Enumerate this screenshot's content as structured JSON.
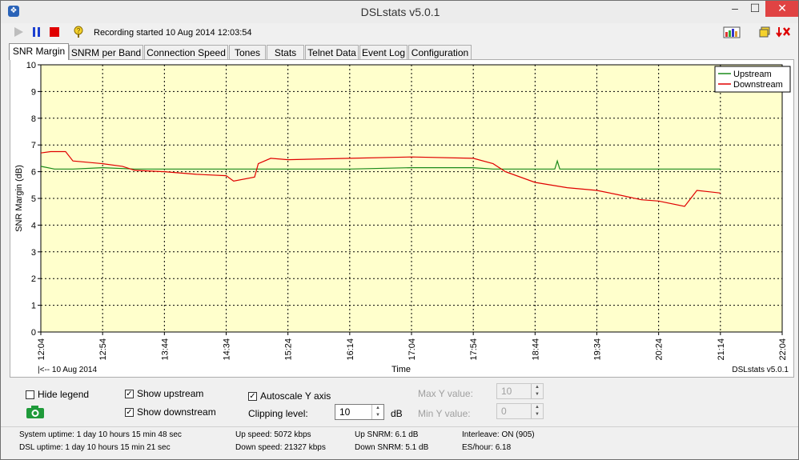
{
  "window": {
    "title": "DSLstats v5.0.1"
  },
  "toolbar": {
    "recording_text": "Recording started 10 Aug 2014 12:03:54"
  },
  "tabs": [
    "SNR Margin",
    "SNRM per Band",
    "Connection Speed",
    "Tones",
    "Stats",
    "Telnet Data",
    "Event Log",
    "Configuration"
  ],
  "chart_data": {
    "type": "line",
    "title": "",
    "xlabel": "Time",
    "ylabel": "SNR Margin (dB)",
    "ylim": [
      0,
      10
    ],
    "yticks": [
      "0",
      "1",
      "2",
      "3",
      "4",
      "5",
      "6",
      "7",
      "8",
      "9",
      "10"
    ],
    "xticks": [
      "12:04",
      "12:54",
      "13:44",
      "14:34",
      "15:24",
      "16:14",
      "17:04",
      "17:54",
      "18:44",
      "19:34",
      "20:24",
      "21:14",
      "22:04"
    ],
    "grid": true,
    "legend_position": "top-right",
    "background": "#ffffcc",
    "date_label": "|<-- 10 Aug 2014",
    "footer_right": "DSLstats v5.0.1",
    "series": [
      {
        "name": "Upstream",
        "color": "#1a8a1a",
        "x": [
          "12:04",
          "12:15",
          "12:30",
          "12:54",
          "13:20",
          "13:44",
          "14:10",
          "14:34",
          "14:57",
          "15:00",
          "15:24",
          "16:14",
          "17:04",
          "17:54",
          "18:10",
          "18:44",
          "19:00",
          "19:02",
          "19:04",
          "19:34",
          "20:24",
          "21:14"
        ],
        "values": [
          6.2,
          6.1,
          6.1,
          6.15,
          6.1,
          6.1,
          6.1,
          6.1,
          6.1,
          6.1,
          6.1,
          6.1,
          6.15,
          6.15,
          6.1,
          6.1,
          6.1,
          6.4,
          6.1,
          6.1,
          6.1,
          6.1
        ]
      },
      {
        "name": "Downstream",
        "color": "#e00000",
        "x": [
          "12:04",
          "12:12",
          "12:24",
          "12:30",
          "12:54",
          "13:10",
          "13:20",
          "13:44",
          "14:10",
          "14:34",
          "14:40",
          "14:57",
          "15:00",
          "15:10",
          "15:24",
          "16:14",
          "17:04",
          "17:54",
          "18:10",
          "18:20",
          "18:44",
          "19:10",
          "19:34",
          "19:50",
          "20:10",
          "20:24",
          "20:45",
          "20:50",
          "20:55",
          "21:14"
        ],
        "values": [
          6.7,
          6.75,
          6.75,
          6.4,
          6.3,
          6.2,
          6.05,
          6.0,
          5.9,
          5.85,
          5.65,
          5.8,
          6.3,
          6.5,
          6.45,
          6.5,
          6.55,
          6.5,
          6.3,
          6.0,
          5.6,
          5.4,
          5.3,
          5.15,
          4.95,
          4.9,
          4.7,
          5.0,
          5.3,
          5.2
        ]
      }
    ]
  },
  "controls": {
    "hide_legend": "Hide legend",
    "show_upstream": "Show upstream",
    "show_downstream": "Show downstream",
    "autoscale": "Autoscale Y axis",
    "clipping_label": "Clipping level:",
    "clipping_value": "10",
    "clipping_unit": "dB",
    "max_y_label": "Max Y value:",
    "max_y_value": "10",
    "min_y_label": "Min Y value:",
    "min_y_value": "0"
  },
  "status": {
    "system_uptime": "System uptime: 1 day 10 hours 15 min 48 sec",
    "dsl_uptime": "DSL uptime: 1 day 10 hours 15 min 21 sec",
    "up_speed": "Up speed: 5072 kbps",
    "down_speed": "Down speed: 21327 kbps",
    "up_snrm": "Up SNRM: 6.1 dB",
    "down_snrm": "Down SNRM: 5.1 dB",
    "interleave": "Interleave: ON (905)",
    "es_hour": "ES/hour: 6.18"
  }
}
